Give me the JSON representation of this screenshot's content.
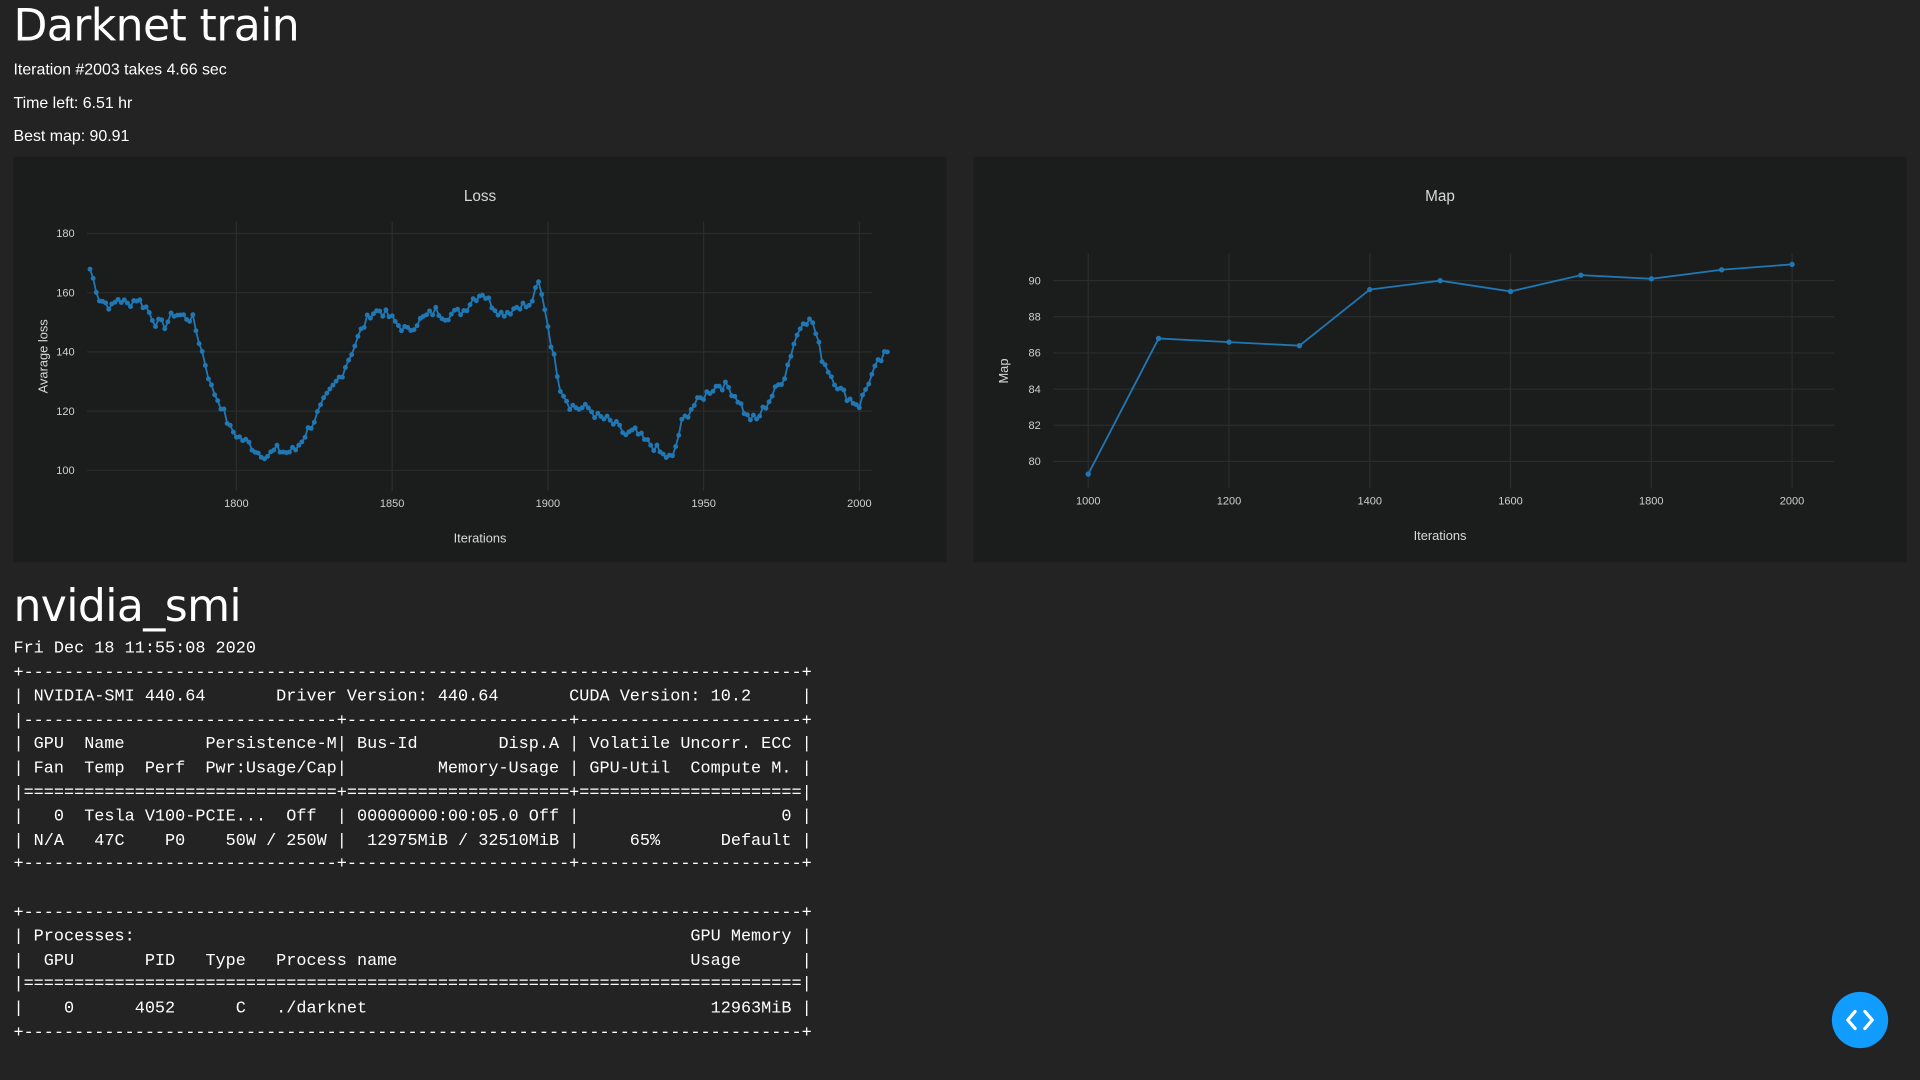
{
  "header": {
    "title": "Darknet train",
    "iteration_text": "Iteration #2003 takes 4.66 sec",
    "time_left_text": "Time left: 6.51 hr",
    "best_map_text": "Best map: 90.91"
  },
  "colors": {
    "background": "#232323",
    "panel": "#1b1c1c",
    "line": "#1f77b4",
    "fab": "#119dff"
  },
  "chart_data": [
    {
      "type": "line",
      "title": "Loss",
      "xlabel": "Iterations",
      "ylabel": "Avarage loss",
      "xlim": [
        1752,
        2004
      ],
      "ylim": [
        93,
        184
      ],
      "xticks": [
        1800,
        1850,
        1900,
        1950,
        2000
      ],
      "yticks": [
        100,
        120,
        140,
        160,
        180
      ],
      "grid": true,
      "markers": true,
      "anchors": [
        [
          1753,
          168
        ],
        [
          1756,
          158
        ],
        [
          1760,
          155
        ],
        [
          1762,
          158
        ],
        [
          1765,
          156
        ],
        [
          1768,
          158
        ],
        [
          1771,
          155
        ],
        [
          1774,
          150
        ],
        [
          1777,
          149
        ],
        [
          1780,
          153
        ],
        [
          1783,
          152
        ],
        [
          1786,
          151
        ],
        [
          1789,
          140
        ],
        [
          1792,
          128
        ],
        [
          1795,
          122
        ],
        [
          1798,
          114
        ],
        [
          1801,
          111
        ],
        [
          1804,
          109
        ],
        [
          1807,
          106
        ],
        [
          1810,
          105
        ],
        [
          1813,
          107
        ],
        [
          1816,
          106
        ],
        [
          1819,
          107
        ],
        [
          1822,
          112
        ],
        [
          1825,
          117
        ],
        [
          1828,
          123
        ],
        [
          1831,
          128
        ],
        [
          1834,
          133
        ],
        [
          1837,
          140
        ],
        [
          1840,
          147
        ],
        [
          1843,
          153
        ],
        [
          1846,
          154
        ],
        [
          1849,
          152
        ],
        [
          1852,
          149
        ],
        [
          1855,
          147
        ],
        [
          1858,
          150
        ],
        [
          1861,
          152
        ],
        [
          1864,
          154
        ],
        [
          1867,
          152
        ],
        [
          1870,
          153
        ],
        [
          1873,
          154
        ],
        [
          1876,
          158
        ],
        [
          1879,
          160
        ],
        [
          1882,
          156
        ],
        [
          1885,
          153
        ],
        [
          1888,
          154
        ],
        [
          1891,
          156
        ],
        [
          1894,
          155
        ],
        [
          1897,
          163
        ],
        [
          1899,
          155
        ],
        [
          1901,
          143
        ],
        [
          1904,
          128
        ],
        [
          1907,
          122
        ],
        [
          1910,
          121
        ],
        [
          1913,
          121
        ],
        [
          1916,
          118
        ],
        [
          1919,
          117
        ],
        [
          1922,
          115
        ],
        [
          1925,
          112
        ],
        [
          1928,
          113
        ],
        [
          1931,
          110
        ],
        [
          1934,
          108
        ],
        [
          1937,
          105
        ],
        [
          1940,
          104
        ],
        [
          1943,
          116
        ],
        [
          1946,
          121
        ],
        [
          1949,
          124
        ],
        [
          1952,
          127
        ],
        [
          1955,
          129
        ],
        [
          1958,
          128
        ],
        [
          1961,
          124
        ],
        [
          1964,
          118
        ],
        [
          1967,
          117
        ],
        [
          1970,
          122
        ],
        [
          1973,
          127
        ],
        [
          1976,
          132
        ],
        [
          1979,
          143
        ],
        [
          1982,
          151
        ],
        [
          1985,
          150
        ],
        [
          1988,
          138
        ],
        [
          1991,
          132
        ],
        [
          1994,
          127
        ],
        [
          1997,
          124
        ],
        [
          2000,
          122
        ],
        [
          2003,
          130
        ],
        [
          2006,
          136
        ],
        [
          2009,
          140
        ]
      ]
    },
    {
      "type": "line",
      "title": "Map",
      "xlabel": "Iterations",
      "ylabel": "Map",
      "xlim": [
        950,
        2060
      ],
      "ylim": [
        78.5,
        91.5
      ],
      "xticks": [
        1000,
        1200,
        1400,
        1600,
        1800,
        2000
      ],
      "yticks": [
        80,
        82,
        84,
        86,
        88,
        90
      ],
      "grid": true,
      "markers": true,
      "x": [
        1000,
        1100,
        1200,
        1300,
        1400,
        1500,
        1600,
        1700,
        1800,
        1900,
        2000
      ],
      "y": [
        79.3,
        86.8,
        86.6,
        86.4,
        89.5,
        90.0,
        89.4,
        90.3,
        90.1,
        90.6,
        90.9
      ]
    }
  ],
  "smi": {
    "title": "nvidia_smi",
    "output": "Fri Dec 18 11:55:08 2020       \n+-----------------------------------------------------------------------------+\n| NVIDIA-SMI 440.64       Driver Version: 440.64       CUDA Version: 10.2     |\n|-------------------------------+----------------------+----------------------+\n| GPU  Name        Persistence-M| Bus-Id        Disp.A | Volatile Uncorr. ECC |\n| Fan  Temp  Perf  Pwr:Usage/Cap|         Memory-Usage | GPU-Util  Compute M. |\n|===============================+======================+======================|\n|   0  Tesla V100-PCIE...  Off  | 00000000:00:05.0 Off |                    0 |\n| N/A   47C    P0    50W / 250W |  12975MiB / 32510MiB |     65%      Default |\n+-------------------------------+----------------------+----------------------+\n                                                                               \n+-----------------------------------------------------------------------------+\n| Processes:                                                       GPU Memory |\n|  GPU       PID   Type   Process name                             Usage      |\n|=============================================================================|\n|    0      4052      C   ./darknet                                  12963MiB |\n+-----------------------------------------------------------------------------+"
  },
  "debug_button": {
    "icon": "code-brackets-icon"
  }
}
